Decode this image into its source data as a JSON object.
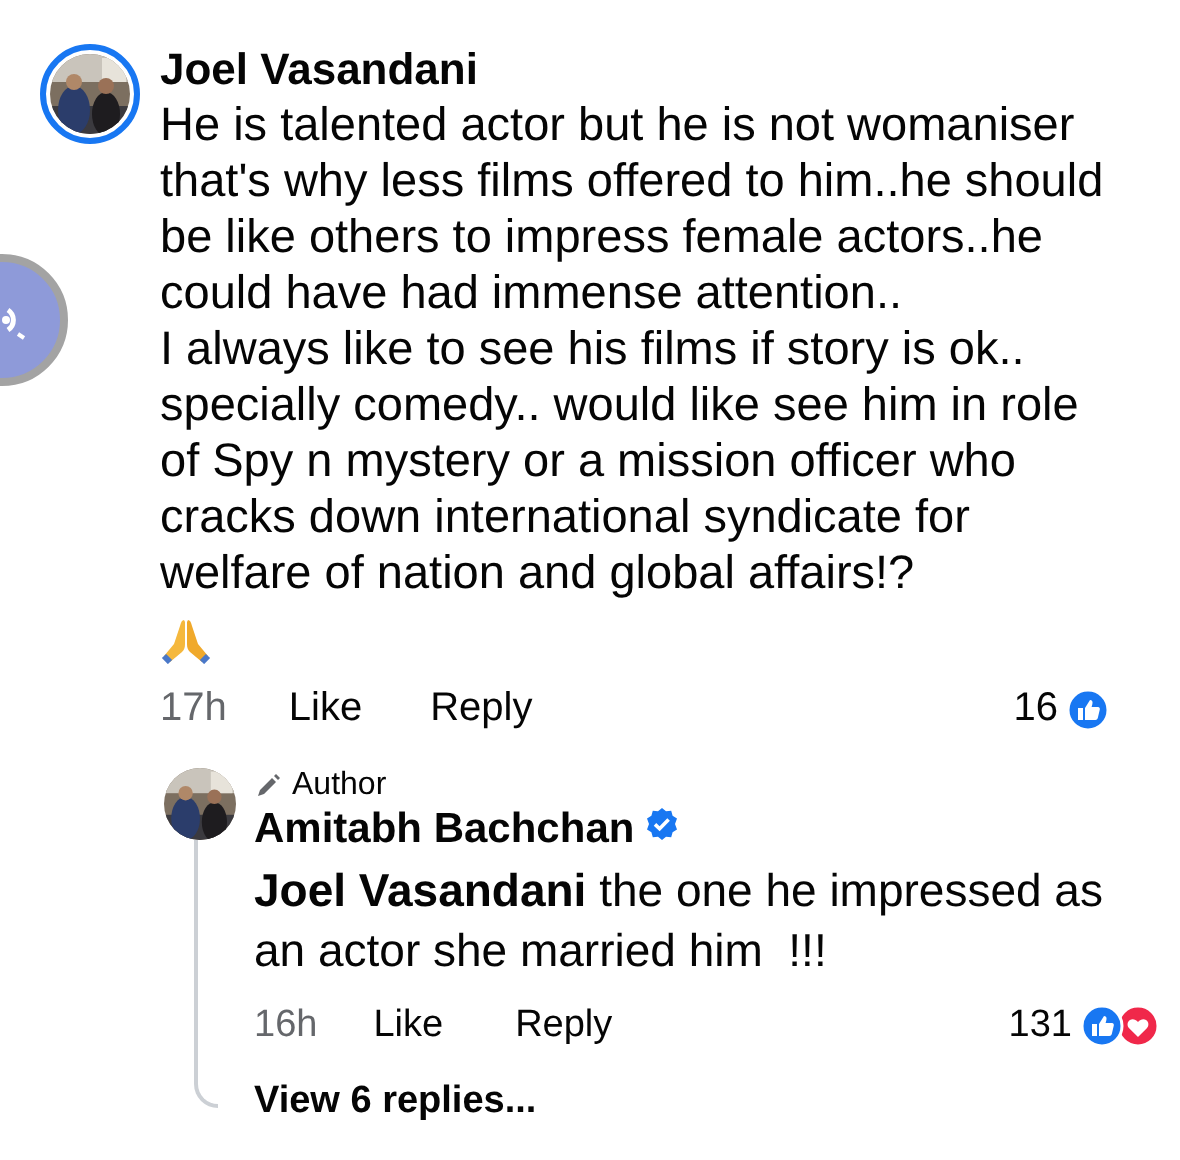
{
  "comment": {
    "author": "Joel Vasandani",
    "story_ring": true,
    "paragraphs": [
      "He is talented actor but he is not womaniser that's why less films offered to him..he should be like others to impress female actors..he could have had immense attention..",
      "I always like to see his films if story is ok.. specially comedy.. would like see him in role of Spy n mystery or a mission officer who cracks down international syndicate for welfare of nation and global affairs!?"
    ],
    "emoji": {
      "kind": "praying-hands"
    },
    "time": "17h",
    "actions": [
      "Like",
      "Reply"
    ],
    "reaction_count": "16",
    "reactions": [
      {
        "kind": "like"
      }
    ]
  },
  "reply": {
    "badge": "Author",
    "author": "Amitabh Bachchan",
    "verified": true,
    "text": "**Joel Vasandani** the one he impressed as an actor she married him  !!!",
    "time": "16h",
    "actions": [
      "Like",
      "Reply"
    ],
    "reaction_count": "131",
    "reactions": [
      {
        "kind": "like"
      },
      {
        "kind": "love"
      }
    ]
  },
  "view_replies": "View 6 replies..."
}
